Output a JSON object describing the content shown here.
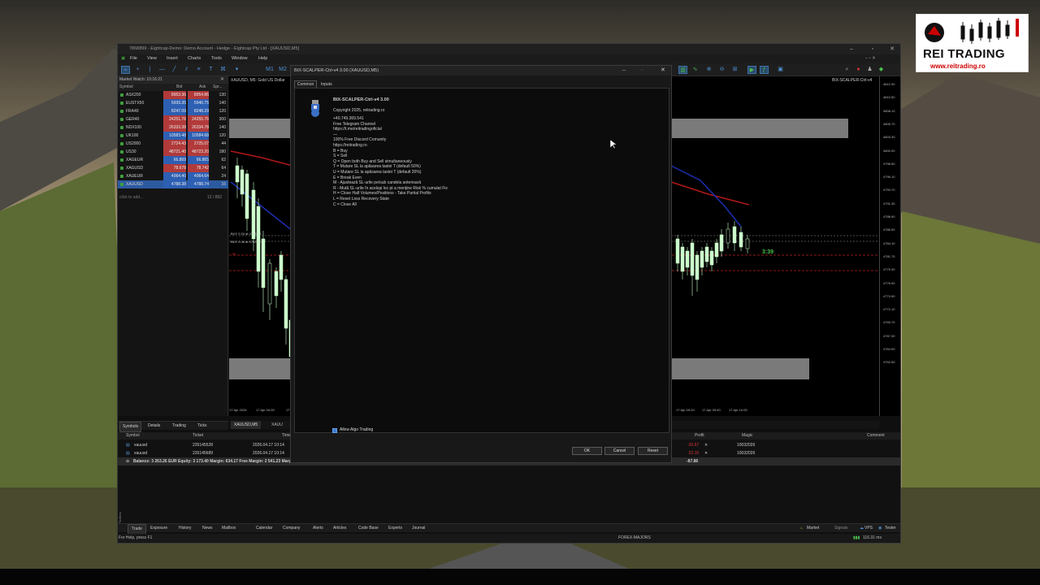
{
  "logo": {
    "title": "REI TRADING",
    "url": "www.reitrading.ro"
  },
  "terminal": {
    "title": "7868899 - Eightcap-Demo: Demo Account - Hedge - Eightcap Pty Ltd - [XAUUSD,M5]",
    "menu": [
      "File",
      "View",
      "Insert",
      "Charts",
      "Tools",
      "Window",
      "Help"
    ],
    "timeframes": [
      "M1",
      "M2"
    ]
  },
  "market_watch": {
    "title": "Market Watch: 10:16:21",
    "columns": [
      "Symbol",
      "Bid",
      "Ask",
      "Spr..."
    ],
    "rows": [
      {
        "symbol": "ASX200",
        "bid": "8953.36",
        "ask": "8954.86",
        "spread": "130",
        "color": "#b23a3a"
      },
      {
        "symbol": "EUSTX50",
        "bid": "5939.35",
        "ask": "5940.75",
        "spread": "140",
        "color": "#2d5fb3"
      },
      {
        "symbol": "FRA40",
        "bid": "8247.09",
        "ask": "8248.29",
        "spread": "120",
        "color": "#2d5fb3"
      },
      {
        "symbol": "GER40",
        "bid": "24251.76",
        "ask": "24255.76",
        "spread": "300",
        "color": "#b23a3a"
      },
      {
        "symbol": "NDX100",
        "bid": "26333.38",
        "ask": "26334.78",
        "spread": "140",
        "color": "#b23a3a"
      },
      {
        "symbol": "UK100",
        "bid": "10583.48",
        "ask": "10584.68",
        "spread": "120",
        "color": "#2d5fb3"
      },
      {
        "symbol": "US2000",
        "bid": "2724.43",
        "ask": "2725.07",
        "spread": "44",
        "color": "#b23a3a"
      },
      {
        "symbol": "US30",
        "bid": "48721.40",
        "ask": "48723.20",
        "spread": "180",
        "color": "#b23a3a"
      },
      {
        "symbol": "XAGEUR",
        "bid": "66.869",
        "ask": "66.865",
        "spread": "62",
        "color": "#2d5fb3"
      },
      {
        "symbol": "XAGUSD",
        "bid": "78.678",
        "ask": "78.742",
        "spread": "64",
        "color": "#b23a3a"
      },
      {
        "symbol": "XAUEUR",
        "bid": "4064.40",
        "ask": "4064.64",
        "spread": "24",
        "color": "#2d5fb3"
      },
      {
        "symbol": "XAUUSD",
        "bid": "4788.38",
        "ask": "4788.74",
        "spread": "16",
        "color": "#2d5fb3"
      }
    ],
    "add_label": "click to add...",
    "count": "12 / 852",
    "tabs": [
      "Symbols",
      "Details",
      "Trading",
      "Ticks"
    ]
  },
  "chart": {
    "header": "XAUUSD, M5: Gold US Dollar",
    "ea_label": "BIX-SCALPER-Ctrl-v4",
    "buy_label_1": "BUY 0.24 at 4792.15",
    "buy_label_2": "BUY 0.44 at 4792.22",
    "sl_label": "SL",
    "countdown": "3:39",
    "dates": [
      "17 Apr 2026",
      "17 Apr 04:00",
      "17 Apr",
      "17 Apr 09:20",
      "17 Apr 09:40",
      "17 Apr 10:00"
    ],
    "prices": [
      "4812.90",
      "4810.50",
      "4808.10",
      "4805.70",
      "4803.30",
      "4800.90",
      "4798.50",
      "4796.10",
      "4793.70",
      "4791.30",
      "4788.90",
      "4786.50",
      "4784.10",
      "4781.70",
      "4779.30",
      "4776.90",
      "4774.50",
      "4772.10",
      "4769.70",
      "4767.30",
      "4764.90",
      "4762.50"
    ],
    "tabs": [
      "XAUUSD,M5",
      "XAUU"
    ]
  },
  "dialog": {
    "title": "BIX-SCALPER-Ctrl-v4 3.00 (XAUUSD,M5)",
    "tabs": [
      "Common",
      "Inputs"
    ],
    "name": "BIX-SCALPER-Ctrl-v4 3.00",
    "lines": [
      "Copyright 2025, reitrading.ro",
      "",
      "+40.749.369.541",
      "Free Telegram Channel",
      "https://t.me/reitradingoficial",
      "—",
      "100% Free Discord Comunity",
      "https://reitrading.ro",
      "B = Buy",
      "S = Sell",
      "Q = Open both Buy and Sell simultaneously",
      "T = Mutare SL la apăsarea tastei T (default 50%)",
      "U = Mutare SL la apăsarea tastei T (default 20%)",
      "E = Break Even",
      "M - Ajustează SL-urile pe/sub candela anterioară",
      "R - Mută SL-urile în același loc pt a menține Risk % cumulat Fix",
      "H = Close Half Volumes/Positions - Take Partial Profits",
      "L = Reset Loss Recovery State",
      "C = Close All"
    ],
    "allow_algo": "Allow Algo Trading",
    "ok": "OK",
    "cancel": "Cancel",
    "reset": "Reset"
  },
  "toolbox": {
    "columns": [
      "Symbol",
      "Ticket",
      "Time",
      "Profit",
      "Magic",
      "Comment"
    ],
    "rows": [
      {
        "symbol": "xauusd",
        "ticket": "226145528",
        "time": "2026.04.17 10:14",
        "profit": "-30.67",
        "magic": "10032026"
      },
      {
        "symbol": "xauusd",
        "ticket": "226145689",
        "time": "2026.04.17 10:14",
        "profit": "-22.15",
        "magic": "10032026"
      }
    ],
    "balance": "Balance: 3 263.26 EUR  Equity: 3 173.40  Margin: 634.17  Free Margin: 2 541.23  Margin Level: 500.72 %",
    "total_profit": "-87.86",
    "tabs": [
      "Trade",
      "Exposure",
      "History",
      "News",
      "Mailbox",
      "Calendar",
      "Company",
      "Alerts",
      "Articles",
      "Code Base",
      "Experts",
      "Journal"
    ],
    "right_tabs": [
      "Market",
      "Signals",
      "VPS",
      "Tester"
    ],
    "side_label": "Toolbox"
  },
  "statusbar": {
    "help": "For Help, press F1",
    "profile": "FOREX-MAJORS",
    "ping": "116.31 ms"
  },
  "colors": {
    "bid_up": "#2d5fb3",
    "bid_down": "#b23a3a",
    "candle": "#ccffcc",
    "ma_red": "#b01818",
    "ma_blue": "#1c2fb0"
  }
}
